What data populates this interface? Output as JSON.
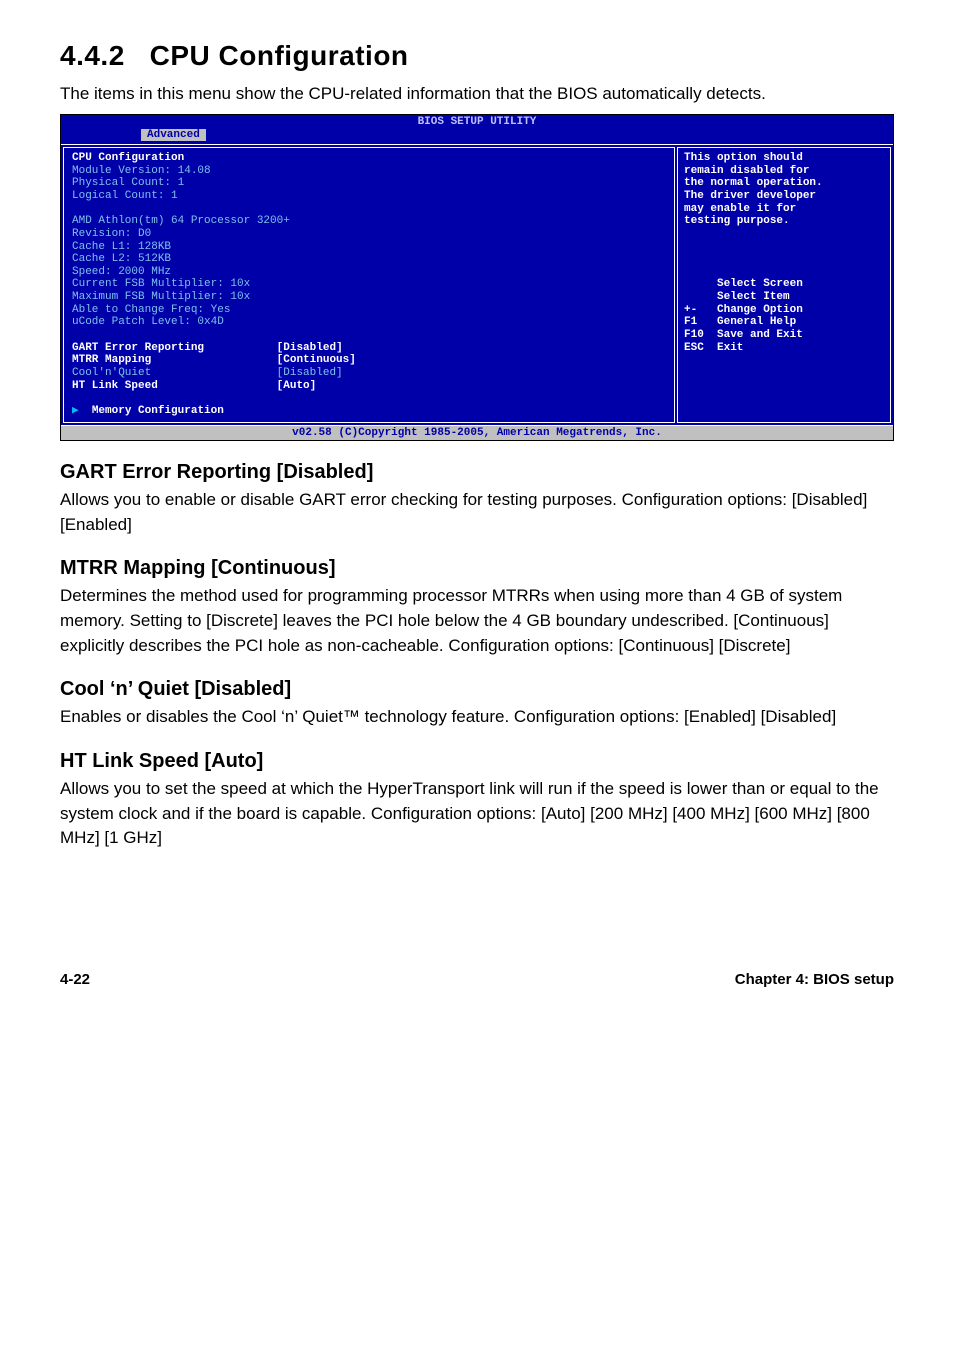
{
  "section": {
    "number": "4.4.2",
    "title": "CPU Configuration",
    "intro": "The items in this menu show the CPU-related information that the BIOS automatically detects."
  },
  "bios": {
    "header": "BIOS SETUP UTILITY",
    "tab": "Advanced",
    "left": {
      "title": "CPU Configuration",
      "info1": "Module Version: 14.08",
      "info2": "Physical Count: 1",
      "info3": "Logical Count: 1",
      "info4": "AMD Athlon(tm) 64 Processor 3200+",
      "info5": "Revision: D0",
      "info6": "Cache L1: 128KB",
      "info7": "Cache L2: 512KB",
      "info8": "Speed: 2000 MHz",
      "info9": "Current FSB Multiplier: 10x",
      "info10": "Maximum FSB Multiplier: 10x",
      "info11": "Able to Change Freq: Yes",
      "info12": "uCode Patch Level: 0x4D",
      "opt1_label": "GART Error Reporting",
      "opt1_val": "[Disabled]",
      "opt2_label": "MTRR Mapping",
      "opt2_val": "[Continuous]",
      "opt3_label": "Cool'n'Quiet",
      "opt3_val": "[Disabled]",
      "opt4_label": "HT Link Speed",
      "opt4_val": "[Auto]",
      "sub1": "Memory Configuration"
    },
    "right": {
      "desc": "This option should\nremain disabled for\nthe normal operation.\nThe driver developer\nmay enable it for\ntesting purpose.",
      "nav": "     Select Screen\n     Select Item\n+-   Change Option\nF1   General Help\nF10  Save and Exit\nESC  Exit"
    },
    "footer": "v02.58 (C)Copyright 1985-2005, American Megatrends, Inc."
  },
  "headings": {
    "h1": "GART Error Reporting [Disabled]",
    "p1": "Allows you to enable or disable GART error checking for testing purposes. Configuration options: [Disabled] [Enabled]",
    "h2": "MTRR Mapping [Continuous]",
    "p2": "Determines the method used for programming processor MTRRs when using more than 4 GB of system memory. Setting to [Discrete] leaves the PCI hole below the 4 GB boundary undescribed. [Continuous] explicitly describes the PCI hole as non-cacheable. Configuration options: [Continuous] [Discrete]",
    "h3": "Cool ‘n’ Quiet [Disabled]",
    "p3": "Enables or disables the Cool ‘n’ Quiet™ technology feature. Configuration options: [Enabled] [Disabled]",
    "h4": "HT Link Speed [Auto]",
    "p4": "Allows you to set the speed at which the HyperTransport link will run if the speed is lower than or equal to the system clock and if the board is capable. Configuration options: [Auto] [200 MHz] [400 MHz] [600 MHz] [800 MHz] [1 GHz]"
  },
  "footer": {
    "page": "4-22",
    "chapter": "Chapter 4: BIOS setup"
  }
}
